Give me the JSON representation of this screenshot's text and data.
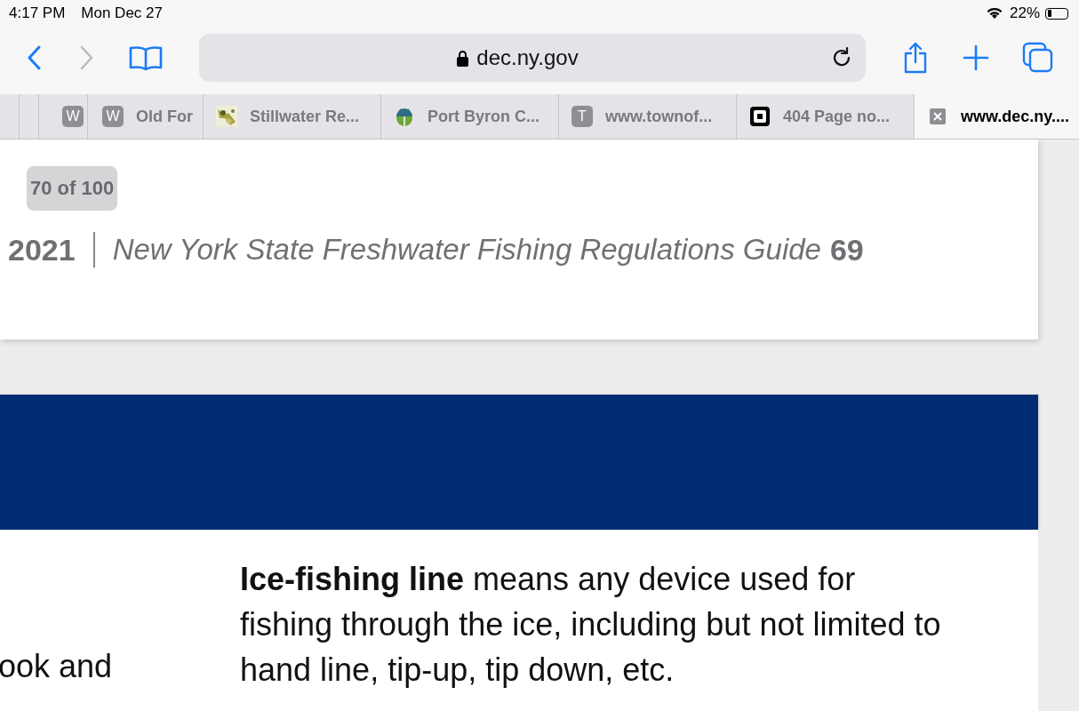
{
  "status_bar": {
    "time": "4:17 PM",
    "date": "Mon Dec 27",
    "battery": "22%"
  },
  "toolbar": {
    "back_enabled": true,
    "forward_enabled": false,
    "address": "dec.ny.gov"
  },
  "tabs": [
    {
      "favicon": {
        "kind": "letter",
        "text": "W"
      },
      "selected": false
    },
    {
      "favicon": {
        "kind": "letter",
        "text": "W"
      },
      "title": "Old For",
      "selected": false
    },
    {
      "title": "Stillwater Re...",
      "selected": false
    },
    {
      "favicon": {
        "kind": "bug"
      },
      "title": "Port Byron C...",
      "selected": false
    },
    {
      "favicon": {
        "kind": "letter",
        "text": "T"
      },
      "title": "www.townof...",
      "selected": false
    },
    {
      "favicon": {
        "kind": "square"
      },
      "title": "404 Page no...",
      "selected": false
    },
    {
      "favicon": {
        "kind": "close"
      },
      "title": "www.dec.ny....",
      "selected": true
    }
  ],
  "page": {
    "page_counter": "70 of 100",
    "header": {
      "year": "2021",
      "title": "New York State Freshwater Fishing Regulations Guide",
      "page_number": "69"
    },
    "left_fragment": "ook and",
    "definition": "**Ice-fishing line** means any device used for fishing through the ice, including but not limited to hand line, tip-up, tip down, etc."
  }
}
